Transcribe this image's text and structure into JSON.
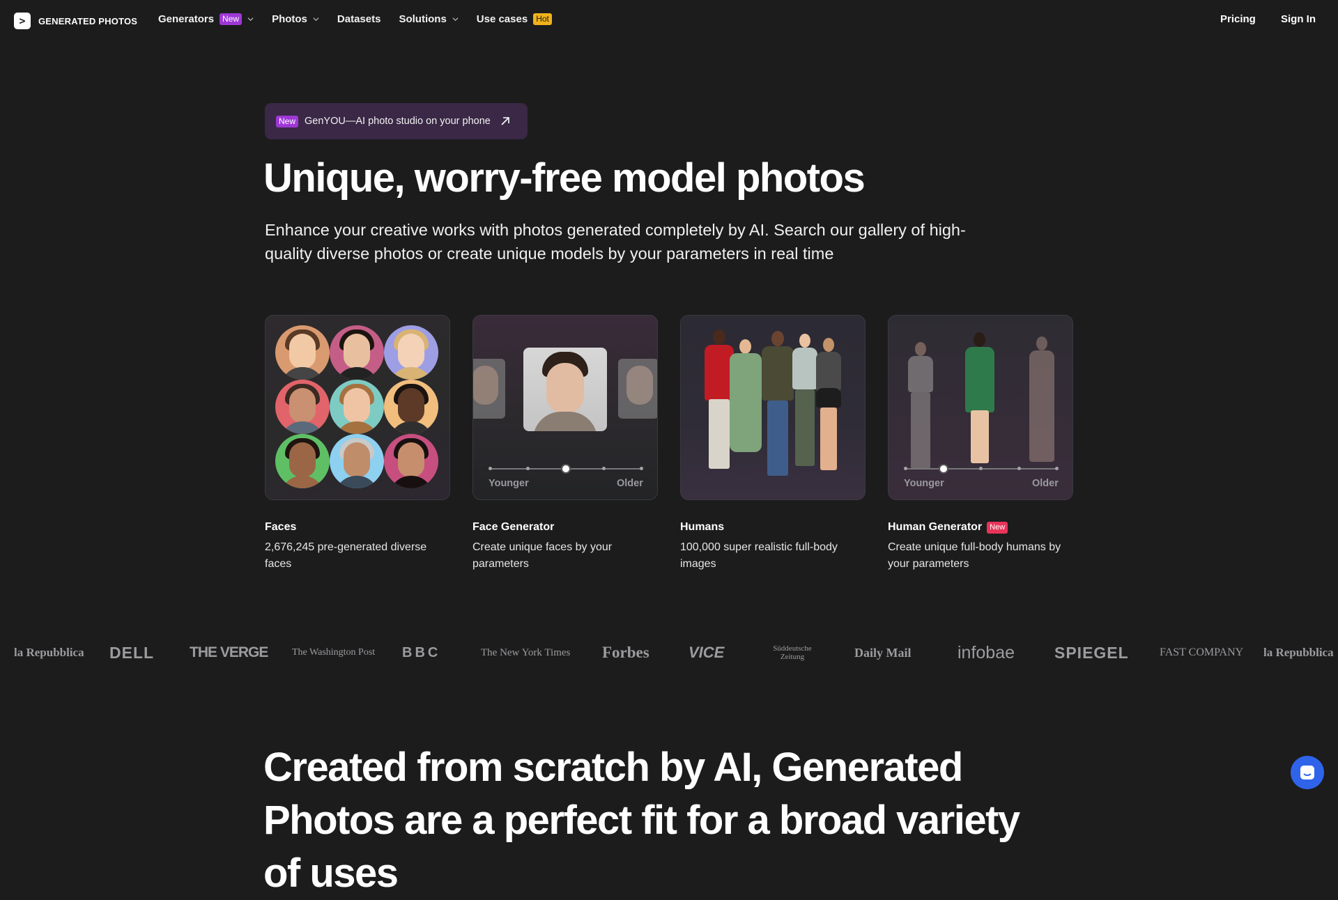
{
  "nav": {
    "logo_text": "GENERATED PHOTOS",
    "items": [
      {
        "label": "Generators",
        "badge": "New"
      },
      {
        "label": "Photos"
      },
      {
        "label": "Datasets"
      },
      {
        "label": "Solutions"
      },
      {
        "label": "Use cases",
        "badge": "Hot"
      }
    ],
    "pricing": "Pricing",
    "sign_in": "Sign In"
  },
  "hero": {
    "promo_badge": "New",
    "promo_text": "GenYOU—AI photo studio on your phone",
    "title": "Unique, worry-free model photos",
    "subtitle": "Enhance your creative works with photos generated completely by AI. Search our gallery of high-quality diverse photos or create unique models by your parameters in real time"
  },
  "cards": [
    {
      "title": "Faces",
      "description": "2,676,245 pre-generated diverse faces"
    },
    {
      "title": "Face Generator",
      "description": "Create unique faces by your parameters",
      "slider_left": "Younger",
      "slider_right": "Older",
      "slider_value": 0.5
    },
    {
      "title": "Humans",
      "description": "100,000 super realistic full-body images"
    },
    {
      "title": "Human Generator",
      "badge": "New",
      "description": "Create unique full-body humans by your parameters",
      "slider_left": "Younger",
      "slider_right": "Older",
      "slider_value": 0.25
    }
  ],
  "press_logos": [
    "la Repubblica",
    "DELL",
    "THE VERGE",
    "The Washington Post",
    "BBC",
    "The New York Times",
    "Forbes",
    "VICE",
    "Süddeutsche Zeitung",
    "Daily Mail",
    "infobae",
    "SPIEGEL",
    "FAST COMPANY",
    "la Repubblica"
  ],
  "section2": {
    "title": "Created from scratch by AI, Generated Photos are a perfect fit for a broad variety of uses"
  },
  "colors": {
    "background": "#1c1c1d",
    "badge_new": "#9d38d6",
    "badge_hot": "#f1b21b",
    "badge_card_new": "#e8345a",
    "chat": "#2f64ea"
  }
}
